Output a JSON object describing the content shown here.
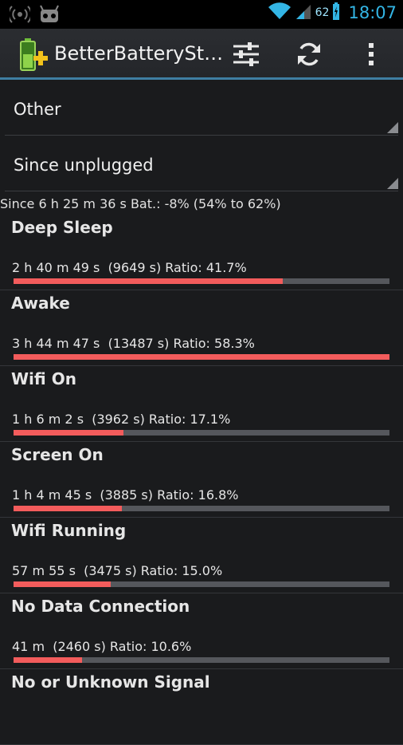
{
  "status_bar": {
    "time": "18:07",
    "battery_percent": "62",
    "icons": [
      "wifi-ap-icon",
      "android-robot-icon",
      "wifi-signal-icon",
      "cell-signal-icon",
      "battery-charging-icon"
    ]
  },
  "action_bar": {
    "title": "BetterBatterySt…",
    "icons": [
      "app-battery-icon",
      "settings-sliders-icon",
      "refresh-icon",
      "overflow-menu-icon"
    ]
  },
  "filters": {
    "type_selected": "Other",
    "reference_selected": "Since unplugged"
  },
  "summary": "Since 6 h 25 m 36 s  Bat.: -8% (54% to 62%)",
  "colors": {
    "accent": "#33b5e5",
    "bar_fill": "#f35c5c",
    "bar_track": "#55575c"
  },
  "stats": [
    {
      "name": "Deep Sleep",
      "detail": "2 h 40 m 49 s  (9649 s) Ratio: 41.7%",
      "ratio": 0.717
    },
    {
      "name": "Awake",
      "detail": "3 h 44 m 47 s  (13487 s) Ratio: 58.3%",
      "ratio": 1.0
    },
    {
      "name": "Wifi On",
      "detail": "1 h 6 m 2 s  (3962 s) Ratio: 17.1%",
      "ratio": 0.293
    },
    {
      "name": "Screen On",
      "detail": "1 h 4 m 45 s  (3885 s) Ratio: 16.8%",
      "ratio": 0.288
    },
    {
      "name": "Wifi Running",
      "detail": "57 m 55 s  (3475 s) Ratio: 15.0%",
      "ratio": 0.258
    },
    {
      "name": "No Data Connection",
      "detail": "41 m  (2460 s) Ratio: 10.6%",
      "ratio": 0.182
    },
    {
      "name": "No or Unknown Signal",
      "detail": "",
      "ratio": null
    }
  ]
}
